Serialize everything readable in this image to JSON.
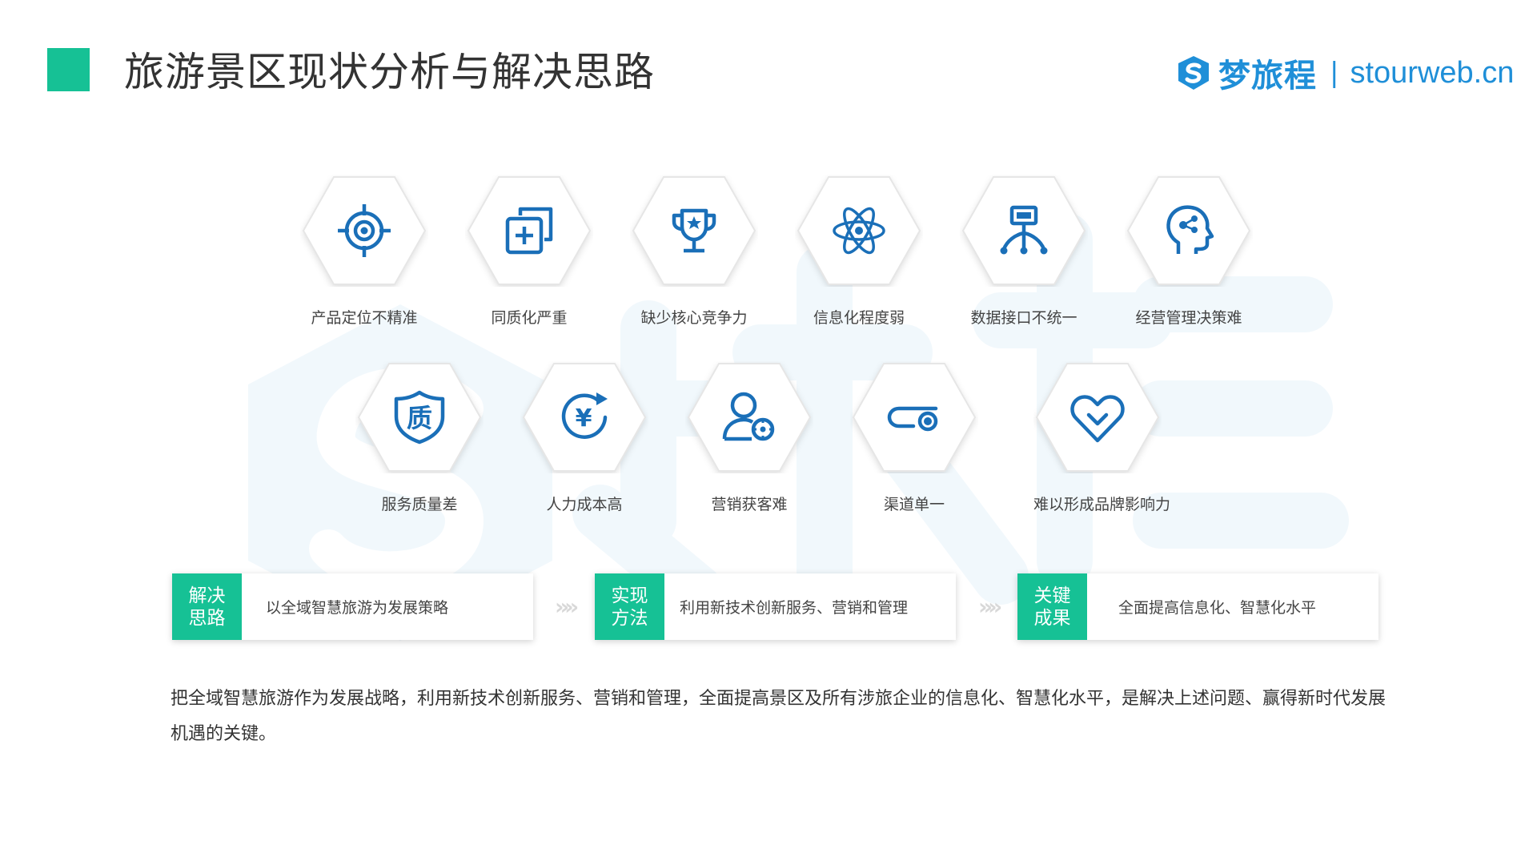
{
  "header": {
    "title": "旅游景区现状分析与解决思路",
    "brand_name": "梦旅程",
    "brand_separator": "|",
    "brand_url": "stourweb.cn",
    "accent_color": "#16c195",
    "brand_color": "#1f8fd8"
  },
  "problems_row1": [
    {
      "label": "产品定位不精准",
      "icon": "target-icon"
    },
    {
      "label": "同质化严重",
      "icon": "duplicate-plus-icon"
    },
    {
      "label": "缺少核心竞争力",
      "icon": "trophy-icon"
    },
    {
      "label": "信息化程度弱",
      "icon": "atom-icon"
    },
    {
      "label": "数据接口不统一",
      "icon": "network-node-icon"
    },
    {
      "label": "经营管理决策难",
      "icon": "head-brain-icon"
    }
  ],
  "problems_row2": [
    {
      "label": "服务质量差",
      "icon": "quality-shield-icon",
      "icon_text": "质"
    },
    {
      "label": "人力成本高",
      "icon": "yen-cycle-icon",
      "icon_text": "¥"
    },
    {
      "label": "营销获客难",
      "icon": "user-target-icon"
    },
    {
      "label": "渠道单一",
      "icon": "toggle-switch-icon"
    },
    {
      "label": "难以形成品牌影响力",
      "icon": "heart-check-icon"
    }
  ],
  "solutions": [
    {
      "tag_line1": "解决",
      "tag_line2": "思路",
      "text": "以全域智慧旅游为发展策略"
    },
    {
      "tag_line1": "实现",
      "tag_line2": "方法",
      "text": "利用新技术创新服务、营销和管理"
    },
    {
      "tag_line1": "关键",
      "tag_line2": "成果",
      "text": "全面提高信息化、智慧化水平"
    }
  ],
  "arrow_glyph": "»»",
  "conclusion": "把全域智慧旅游作为发展战略，利用新技术创新服务、营销和管理，全面提高景区及所有涉旅企业的信息化、智慧化水平，是解决上述问题、赢得新时代发展机遇的关键。"
}
